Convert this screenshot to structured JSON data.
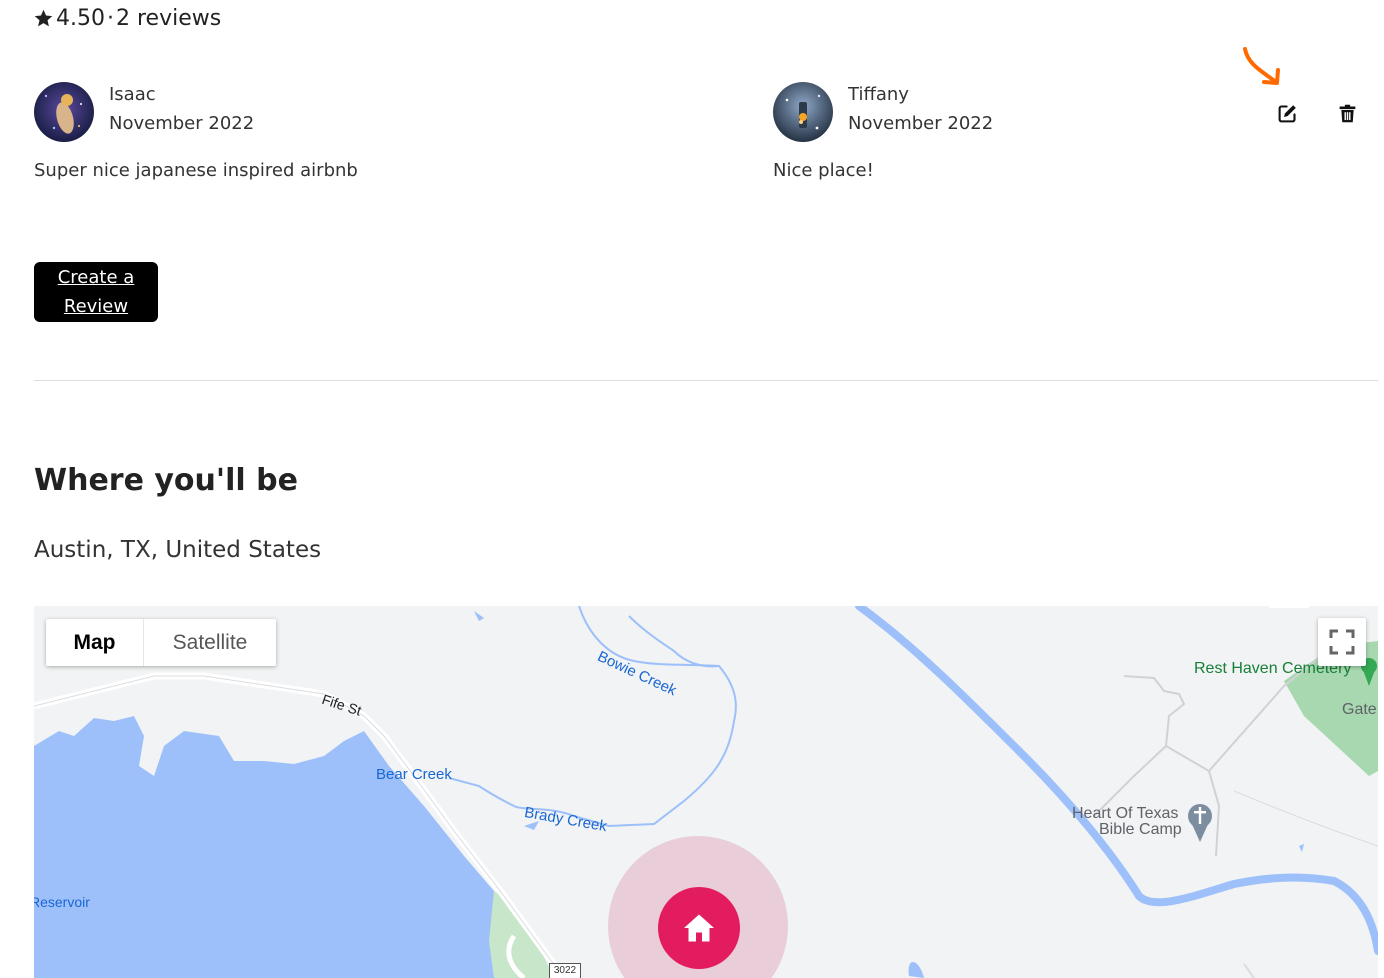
{
  "reviews_summary": {
    "rating": "4.50",
    "separator": "·",
    "count_label": "2 reviews"
  },
  "reviews": [
    {
      "name": "Isaac",
      "date": "November 2022",
      "text": "Super nice japanese inspired airbnb",
      "avatar_icon": "avatar-photo"
    },
    {
      "name": "Tiffany",
      "date": "November 2022",
      "text": "Nice place!",
      "avatar_icon": "avatar-photo"
    }
  ],
  "review_actions": {
    "edit_icon": "edit-icon",
    "delete_icon": "trash-icon"
  },
  "create_review": {
    "label": "Create a Review"
  },
  "location_section": {
    "title": "Where you'll be",
    "location": "Austin, TX, United States"
  },
  "map": {
    "type_buttons": [
      "Map",
      "Satellite"
    ],
    "selected_type": "Map",
    "labels": {
      "fife": "Fife St",
      "bowie": "Bowie Creek",
      "bear": "Bear Creek",
      "brady": "Brady Creek",
      "reservoir": "Reservoir",
      "rest_haven": "Rest Haven Cemetery",
      "gate": "Gate",
      "heart1": "Heart Of Texas",
      "heart2": "Bible Camp",
      "route": "3022"
    },
    "marker_icon": "home-icon"
  },
  "colors": {
    "accent": "#e31c5f",
    "button_bg": "#000000",
    "water": "#9dc0fa",
    "land": "#f1f3f4",
    "park": "#a8d8b0",
    "annotation_arrow": "#ff6a00"
  }
}
